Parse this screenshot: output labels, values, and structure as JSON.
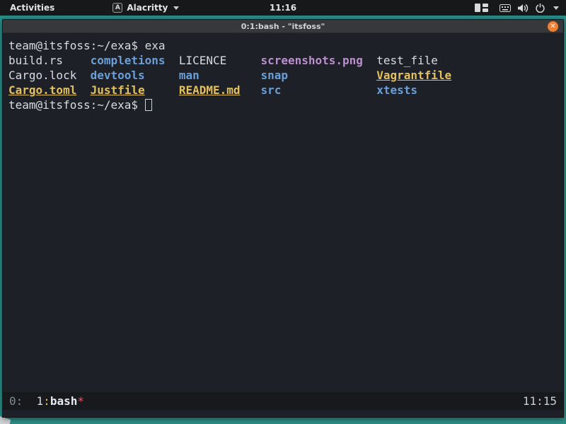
{
  "topbar": {
    "activities_label": "Activities",
    "app_name": "Alacritty",
    "app_icon_letter": "A",
    "clock": "11:16"
  },
  "window": {
    "title": "0:1:bash - \"itsfoss\"",
    "close_glyph": "✕"
  },
  "terminal": {
    "palette": {
      "fg": "#d8dce2",
      "dim": "#848a93",
      "blue": "#6a9fd8",
      "yellow": "#e3c05e",
      "magenta": "#bb8fce",
      "red": "#e3566b"
    },
    "prompt": "team@itsfoss:~/exa$",
    "command": "exa",
    "lines": [
      {
        "cells": [
          {
            "text": "team@itsfoss:~/exa$ exa",
            "style": "fg",
            "col": 0
          }
        ]
      },
      {
        "cells": [
          {
            "text": "build.rs",
            "style": "fg",
            "col": 0
          },
          {
            "text": "completions",
            "style": "dir",
            "col": 12
          },
          {
            "text": "LICENCE",
            "style": "fg",
            "col": 25
          },
          {
            "text": "screenshots.png",
            "style": "img",
            "col": 37
          },
          {
            "text": "test_file",
            "style": "fg",
            "col": 54
          }
        ]
      },
      {
        "cells": [
          {
            "text": "Cargo.lock",
            "style": "fg",
            "col": 0
          },
          {
            "text": "devtools",
            "style": "dir",
            "col": 12
          },
          {
            "text": "man",
            "style": "dir",
            "col": 25
          },
          {
            "text": "snap",
            "style": "dir",
            "col": 37
          },
          {
            "text": "Vagrantfile",
            "style": "build",
            "col": 54
          }
        ]
      },
      {
        "cells": [
          {
            "text": "Cargo.toml",
            "style": "build",
            "col": 0
          },
          {
            "text": "Justfile",
            "style": "build",
            "col": 12
          },
          {
            "text": "README.md",
            "style": "build",
            "col": 25
          },
          {
            "text": "src",
            "style": "dir",
            "col": 37
          },
          {
            "text": "xtests",
            "style": "dir",
            "col": 54
          }
        ]
      },
      {
        "cells": [
          {
            "text": "team@itsfoss:~/exa$ ",
            "style": "fg",
            "col": 0
          },
          {
            "text": " ",
            "style": "fg",
            "cursor": true
          }
        ]
      }
    ]
  },
  "statusbar": {
    "segments": [
      {
        "text": "0:",
        "style": "dim"
      },
      {
        "text": "  ",
        "style": "fg"
      },
      {
        "text": "1",
        "style": "fg"
      },
      {
        "text": ":",
        "style": "yellow"
      },
      {
        "text": "bash",
        "style": "bold"
      },
      {
        "text": "*",
        "style": "red"
      }
    ],
    "clock": "11:15"
  }
}
